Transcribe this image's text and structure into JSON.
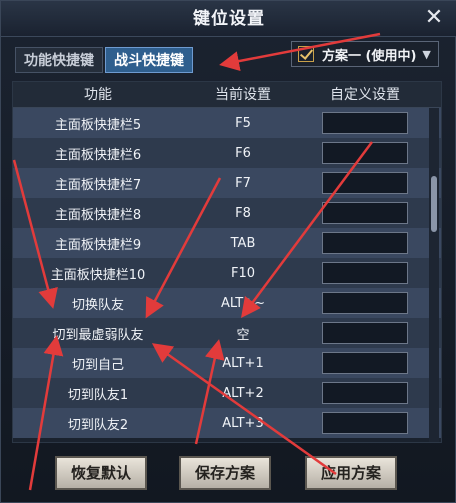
{
  "window": {
    "title": "键位设置"
  },
  "tabs": [
    {
      "label": "功能快捷键",
      "active": false
    },
    {
      "label": "战斗快捷键",
      "active": true
    }
  ],
  "scheme": {
    "label": "方案一 (使用中)"
  },
  "table": {
    "headers": [
      "功能",
      "当前设置",
      "自定义设置"
    ],
    "rows": [
      {
        "name": "主面板快捷栏5",
        "key": "F5"
      },
      {
        "name": "主面板快捷栏6",
        "key": "F6"
      },
      {
        "name": "主面板快捷栏7",
        "key": "F7"
      },
      {
        "name": "主面板快捷栏8",
        "key": "F8"
      },
      {
        "name": "主面板快捷栏9",
        "key": "TAB"
      },
      {
        "name": "主面板快捷栏10",
        "key": "F10"
      },
      {
        "name": "切换队友",
        "key": "ALT+~"
      },
      {
        "name": "切到最虚弱队友",
        "key": "空"
      },
      {
        "name": "切到自己",
        "key": "ALT+1"
      },
      {
        "name": "切到队友1",
        "key": "ALT+2"
      },
      {
        "name": "切到队友2",
        "key": "ALT+3"
      }
    ]
  },
  "buttons": {
    "reset": "恢复默认",
    "save": "保存方案",
    "apply": "应用方案"
  },
  "colors": {
    "accent_tab": "#2f5f8e",
    "annotation_arrow": "#e23b3b"
  }
}
